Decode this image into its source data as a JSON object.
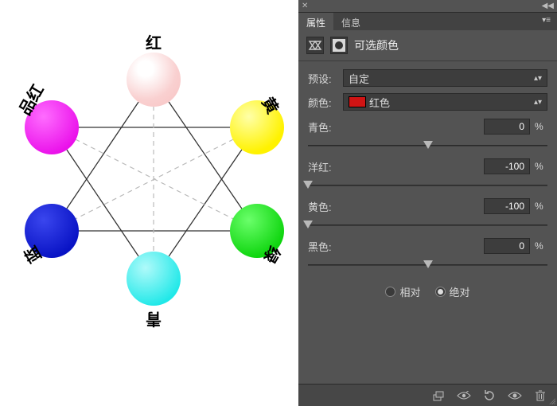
{
  "wheel": {
    "labels": {
      "top": "红",
      "top_right": "黄",
      "bottom_right": "绿",
      "bottom": "青",
      "bottom_left": "蓝",
      "top_left": "品红"
    },
    "colors": {
      "top": "#f8e0e0",
      "top_right": "#fff200",
      "bottom_right": "#0ee000",
      "bottom": "#2cf0f0",
      "bottom_left": "#0a16d0",
      "top_left": "#ef1af0"
    }
  },
  "panel": {
    "tabs": {
      "properties": "属性",
      "info": "信息"
    },
    "title": "可选颜色",
    "preset_label": "预设:",
    "preset_value": "自定",
    "colors_label": "颜色:",
    "colors_value": "红色",
    "swatch_color": "#d01414",
    "sliders": [
      {
        "label": "青色:",
        "value": "0",
        "pos_pct": 50
      },
      {
        "label": "洋红:",
        "value": "-100",
        "pos_pct": 0
      },
      {
        "label": "黄色:",
        "value": "-100",
        "pos_pct": 0
      },
      {
        "label": "黑色:",
        "value": "0",
        "pos_pct": 50
      }
    ],
    "percent": "%",
    "radio": {
      "relative": "相对",
      "absolute": "绝对",
      "selected": "absolute"
    }
  }
}
